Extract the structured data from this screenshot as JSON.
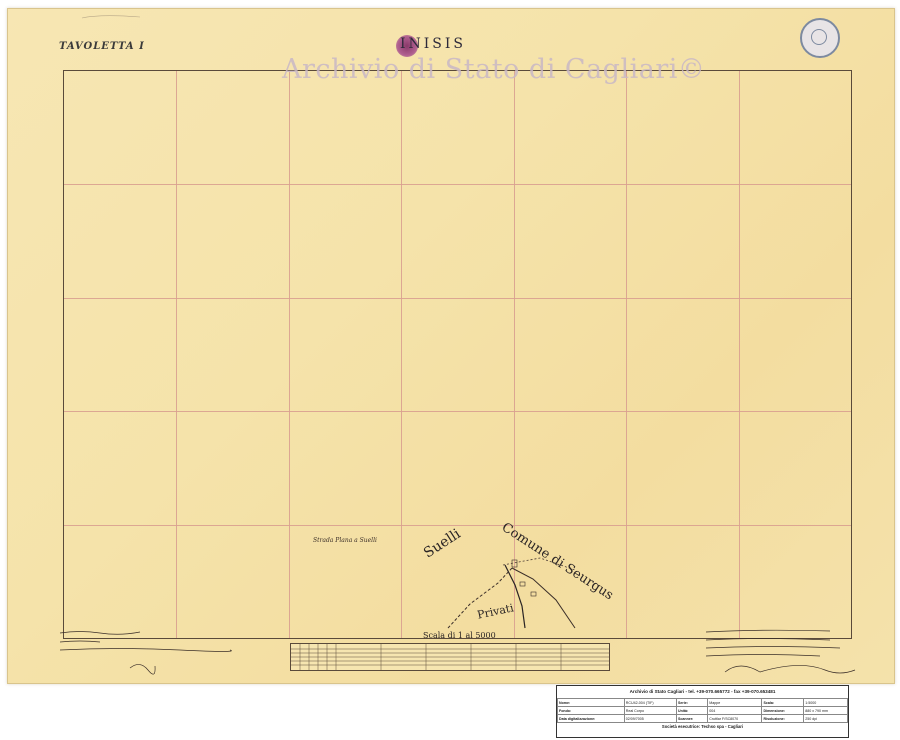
{
  "sheet": {
    "label": "TAVOLETTA I",
    "title": "INISIS",
    "watermark": "Archivio di Stato di Cagliari©"
  },
  "map": {
    "place_labels": {
      "suelli": "Suelli",
      "comune_di_seurgus": "Comune di Seurgus",
      "privati": "Privati",
      "strada": "Strada Plana a Suelli"
    },
    "scale_label": "Scala di 1 al 5000"
  },
  "info_panel": {
    "title": "Archivio di Stato Cagliari - tel. +39-070.665772 - fax +39-070.653481",
    "rows": [
      [
        "Nome:",
        "RCU42-004 (TIF)",
        "Serie:",
        "Mappe",
        "Scala:",
        "1:5000"
      ],
      [
        "Fondo:",
        "Real Corpo",
        "Unità:",
        "004",
        "Dimensione:",
        "880 x 790 mm"
      ],
      [
        "Data digitalizzazione:",
        "02/09/7005",
        "Scanner:",
        "Cruttlar F/SC8070",
        "Risoluzione:",
        "250 dpi"
      ]
    ],
    "footer": "Società esecutrice: Techso spa - Cagliari"
  },
  "colors": {
    "paper": "#f5e3aa",
    "grid": "#d9a090",
    "ink": "#2a2424",
    "watermark": "#c9b8c6"
  }
}
